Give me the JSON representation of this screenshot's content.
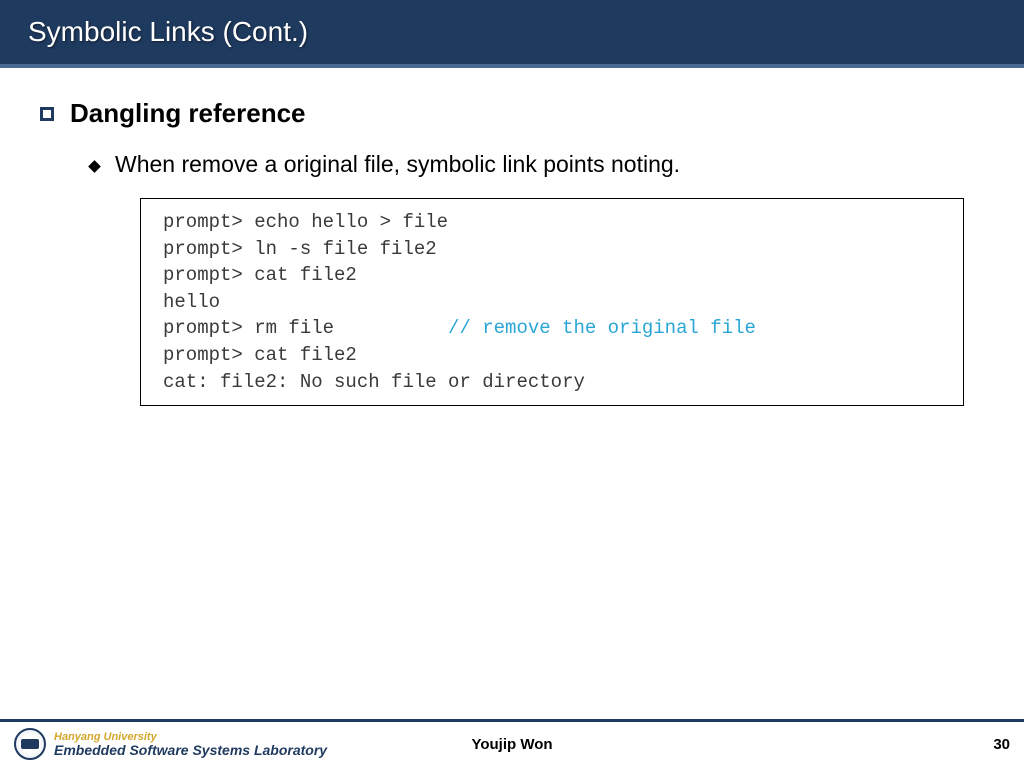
{
  "header": {
    "title": "Symbolic Links (Cont.)"
  },
  "content": {
    "heading": "Dangling reference",
    "subtext": "When remove a original file, symbolic link points noting.",
    "code": {
      "line1": "prompt> echo hello > file",
      "line2": "prompt> ln -s file file2",
      "line3": "prompt> cat file2",
      "line4": "hello",
      "line5a": "prompt> rm file          ",
      "line5b": "// remove the original file",
      "line6": "prompt> cat file2",
      "line7": "cat: file2: No such file or directory"
    }
  },
  "footer": {
    "university": "Hanyang University",
    "lab": "Embedded Software Systems Laboratory",
    "author": "Youjip Won",
    "page": "30"
  }
}
